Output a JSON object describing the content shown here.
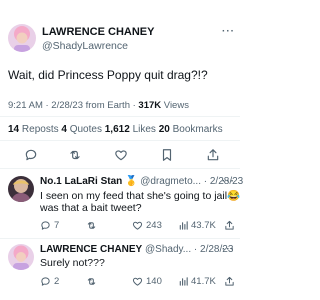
{
  "tweet": {
    "author_name": "LAWRENCE CHANEY",
    "author_handle": "@ShadyLawrence",
    "text": "Wait, did Princess Poppy quit drag?!?",
    "meta_prefix": "9:21 AM · 2/28/23 from Earth · ",
    "views_count": "317K",
    "views_label": " Views",
    "stats": {
      "reposts_count": "14",
      "reposts_label": "Reposts",
      "quotes_count": "4",
      "quotes_label": "Quotes",
      "likes_count": "1,612",
      "likes_label": "Likes",
      "bookmarks_count": "20",
      "bookmarks_label": "Bookmarks"
    },
    "more_label": "···"
  },
  "replies": [
    {
      "author_name": "No.1 LaLaRi Stan 🥇",
      "author_handle": "@dragmeto...",
      "date": "· 2/28/23",
      "line1": "I seen on my feed that she's going to jail😂",
      "line2": "was that a bait tweet?",
      "reply_count": "7",
      "repost_count": "",
      "like_count": "243",
      "views_count": "43.7K",
      "more_label": "···"
    },
    {
      "author_name": "LAWRENCE CHANEY",
      "author_handle": "@Shady...",
      "date": "· 2/28/23",
      "line1": "Surely not???",
      "reply_count": "2",
      "repost_count": "",
      "like_count": "140",
      "views_count": "41.7K",
      "more_label": "···"
    }
  ],
  "icons": {
    "reply": "reply-icon",
    "repost": "repost-icon",
    "like": "heart-icon",
    "bookmark": "bookmark-icon",
    "share": "share-icon",
    "views": "views-icon",
    "more": "more-icon"
  },
  "colors": {
    "text": "#0f1419",
    "muted": "#536471",
    "divider": "#eff3f4",
    "icon": "#536471"
  }
}
